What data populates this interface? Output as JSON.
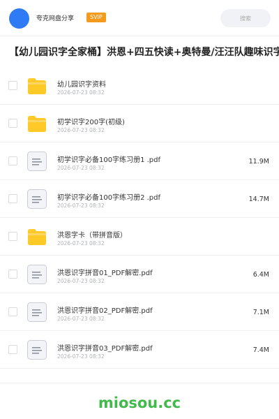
{
  "header": {
    "brand": "夸克网盘分享",
    "badge": "SVIP",
    "search_placeholder": "搜索"
  },
  "title": "【幼儿园识字全家桶】洪恩+四五快读+奥特曼/汪汪队趣味识字",
  "files": [
    {
      "type": "folder",
      "name": "幼儿园识字资料",
      "date": "2026-07-23 08:32",
      "size": ""
    },
    {
      "type": "folder",
      "name": "初学识字200字(初级)",
      "date": "2026-07-23 08:32",
      "size": ""
    },
    {
      "type": "doc",
      "name": "初学识字必备100字练习册1 .pdf",
      "date": "2026-07-23 08:32",
      "size": "11.9M"
    },
    {
      "type": "doc",
      "name": "初学识字必备100字练习册2 .pdf",
      "date": "2026-07-23 08:32",
      "size": "14.7M"
    },
    {
      "type": "folder",
      "name": "洪恩字卡（带拼音版）",
      "date": "2026-07-23 08:32",
      "size": ""
    },
    {
      "type": "doc",
      "name": "洪恩识字拼音01_PDF解密.pdf",
      "date": "2026-07-23 08:32",
      "size": "6.4M"
    },
    {
      "type": "doc",
      "name": "洪恩识字拼音02_PDF解密.pdf",
      "date": "2026-07-23 08:32",
      "size": "7.1M"
    },
    {
      "type": "doc",
      "name": "洪恩识字拼音03_PDF解密.pdf",
      "date": "2026-07-23 08:32",
      "size": "7.4M"
    }
  ],
  "watermark": "miosou.cc",
  "colors": {
    "accent": "#2f7bf6",
    "badge": "#f49a1c",
    "folder": "#ffc928",
    "watermark": "#41b94b"
  },
  "icons": {
    "folder": "folder-icon",
    "doc": "document-icon"
  }
}
